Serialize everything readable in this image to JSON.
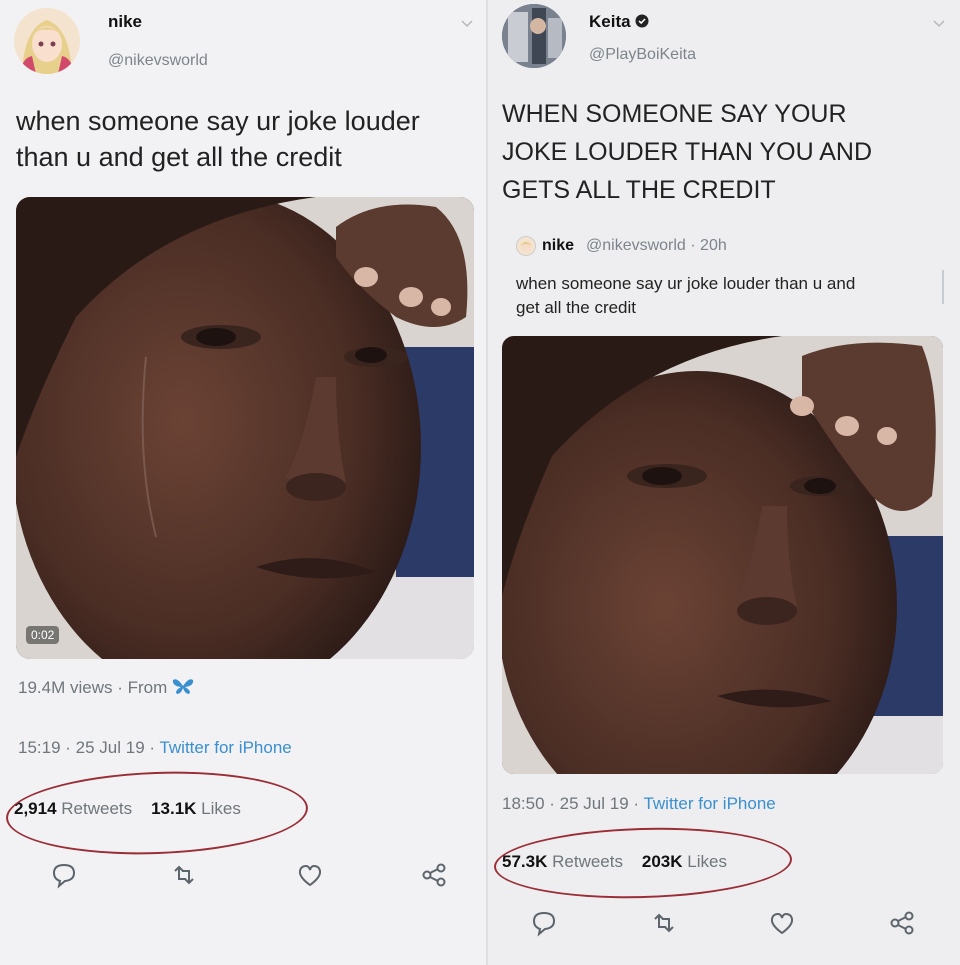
{
  "left_tweet": {
    "name": "nike",
    "handle": "@nikevsworld",
    "text_line1": "when someone say ur joke louder",
    "text_line2": "than u and get all the credit",
    "video_timestamp": "0:02",
    "views": "19.4M views",
    "views_sep": "·",
    "from_label": "From",
    "time": "15:19 · 25 Jul 19 · ",
    "client": "Twitter for iPhone",
    "retweets_count": "2,914",
    "retweets_label": "Retweets",
    "likes_count": "13.1K",
    "likes_label": "Likes"
  },
  "right_tweet": {
    "name": "Keita",
    "handle": "@PlayBoiKeita",
    "text_line1": "WHEN SOMEONE SAY YOUR",
    "text_line2": "JOKE LOUDER THAN YOU AND",
    "text_line3": "GETS ALL THE CREDIT",
    "quoted": {
      "name": "nike",
      "handle": "@nikevsworld · 20h",
      "text_line1": "when someone say ur joke louder than u and",
      "text_line2": "get all the credit"
    },
    "time": "18:50 · 25 Jul 19 · ",
    "client": "Twitter for iPhone",
    "retweets_count": "57.3K",
    "retweets_label": "Retweets",
    "likes_count": "203K",
    "likes_label": "Likes"
  },
  "colors": {
    "annotation_circle": "#9a2d35",
    "link": "#3a8fd0",
    "muted": "#6f767c"
  },
  "icons": [
    "reply-icon",
    "retweet-icon",
    "like-icon",
    "share-icon",
    "verified-icon",
    "butterfly-icon",
    "chevron-down-icon"
  ]
}
